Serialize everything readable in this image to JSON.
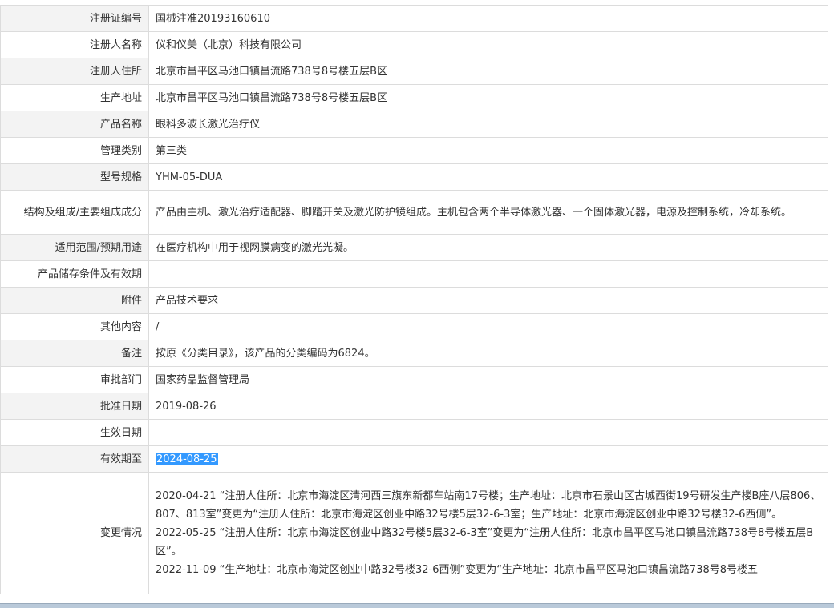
{
  "rows": [
    {
      "label": "注册证编号",
      "value": "国械注准20193160610"
    },
    {
      "label": "注册人名称",
      "value": "仪和仪美（北京）科技有限公司"
    },
    {
      "label": "注册人住所",
      "value": "北京市昌平区马池口镇昌流路738号8号楼五层B区"
    },
    {
      "label": "生产地址",
      "value": "北京市昌平区马池口镇昌流路738号8号楼五层B区"
    },
    {
      "label": "产品名称",
      "value": "眼科多波长激光治疗仪"
    },
    {
      "label": "管理类别",
      "value": "第三类"
    },
    {
      "label": "型号规格",
      "value": "YHM-05-DUA"
    },
    {
      "label": "结构及组成/主要组成成分",
      "value": "产品由主机、激光治疗适配器、脚踏开关及激光防护镜组成。主机包含两个半导体激光器、一个固体激光器，电源及控制系统，冷却系统。"
    },
    {
      "label": "适用范围/预期用途",
      "value": "在医疗机构中用于视网膜病变的激光光凝。"
    },
    {
      "label": "产品储存条件及有效期",
      "value": ""
    },
    {
      "label": "附件",
      "value": "产品技术要求"
    },
    {
      "label": "其他内容",
      "value": "/"
    },
    {
      "label": "备注",
      "value": "按原《分类目录》，该产品的分类编码为6824。"
    },
    {
      "label": "审批部门",
      "value": "国家药品监督管理局"
    },
    {
      "label": "批准日期",
      "value": "2019-08-26"
    },
    {
      "label": "生效日期",
      "value": ""
    },
    {
      "label": "有效期至",
      "value": "2024-08-25"
    }
  ],
  "changes": {
    "label": "变更情况",
    "items": [
      "2020-04-21 “注册人住所：北京市海淀区清河西三旗东新都车站南17号楼；生产地址：北京市石景山区古城西街19号研发生产楼B座八层806、807、813室”变更为“注册人住所：北京市海淀区创业中路32号楼5层32-6-3室；生产地址：北京市海淀区创业中路32号楼32-6西侧”。",
      "2022-05-25 “注册人住所：北京市海淀区创业中路32号楼5层32-6-3室”变更为“注册人住所：北京市昌平区马池口镇昌流路738号8号楼五层B区”。",
      "2022-11-09 “生产地址：北京市海淀区创业中路32号楼32-6西侧”变更为“生产地址：北京市昌平区马池口镇昌流路738号8号楼五"
    ]
  },
  "colors": {
    "selection": "#3399ff",
    "border": "#dcdcdc",
    "label_bg": "#f3f3f3"
  }
}
